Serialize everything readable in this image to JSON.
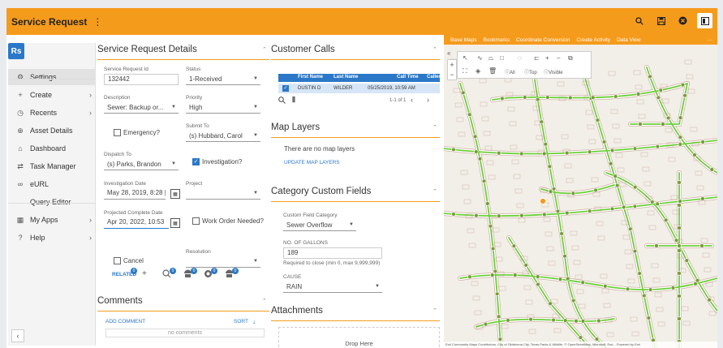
{
  "app": {
    "title": "Service Request",
    "menu_dots": "⋮",
    "logo": "Rs"
  },
  "topbar_icons": [
    "search-icon",
    "save-icon",
    "close-icon",
    "panel-icon"
  ],
  "sidebar": {
    "items": [
      {
        "icon": "⚙",
        "label": "Settings",
        "arrow": "",
        "active": true
      },
      {
        "icon": "+",
        "label": "Create",
        "arrow": "›"
      },
      {
        "icon": "◷",
        "label": "Recents",
        "arrow": "›"
      },
      {
        "icon": "⊕",
        "label": "Asset Details",
        "arrow": ""
      },
      {
        "icon": "⌂",
        "label": "Dashboard",
        "arrow": ""
      },
      {
        "icon": "⇄",
        "label": "Task Manager",
        "arrow": ""
      },
      {
        "icon": "∞",
        "label": "eURL",
        "arrow": ""
      },
      {
        "icon": "",
        "label": "Query Editor",
        "arrow": ""
      },
      {
        "icon": "▦",
        "label": "My Apps",
        "arrow": "›"
      },
      {
        "icon": "?",
        "label": "Help",
        "arrow": "›"
      }
    ],
    "collapse": "‹"
  },
  "details": {
    "title": "Service Request Details",
    "request_id_label": "Service Request Id",
    "request_id": "132442",
    "status_label": "Status",
    "status": "1-Received",
    "description_label": "Description",
    "description": "Sewer: Backup or...",
    "priority_label": "Priority",
    "priority": "High",
    "emergency_label": "Emergency?",
    "submit_to_label": "Submit To",
    "submit_to": "(s) Hubbard, Carol",
    "dispatch_to_label": "Dispatch To",
    "dispatch_to": "(s) Parks, Brandon",
    "investigation_label": "Investigation?",
    "investigation_date_label": "Investigation Date",
    "investigation_date": "May 28, 2019, 8:28 |",
    "project_label": "Project",
    "project": "",
    "projected_complete_label": "Projected Complete Date",
    "projected_complete": "Apr 20, 2022, 10:53",
    "work_order_label": "Work Order Needed?",
    "resolution_label": "Resolution",
    "resolution": "",
    "cancel_label": "Cancel",
    "related_label": "RELATED",
    "related_badge": "0",
    "badges": [
      "0",
      "0",
      "0",
      "0"
    ]
  },
  "comments": {
    "title": "Comments",
    "add": "ADD COMMENT",
    "sort": "SORT",
    "empty": "no comments"
  },
  "customer_calls": {
    "title": "Customer Calls",
    "columns": [
      "First Name",
      "Last Name",
      "Call Time",
      "Caller"
    ],
    "rows": [
      {
        "first": "DUSTIN D",
        "last": "WILDER",
        "time": "05/25/2019, 10:59 AM",
        "caller": ""
      }
    ],
    "pager": "1-1 of 1"
  },
  "map_layers": {
    "title": "Map Layers",
    "empty": "There are no map layers",
    "update": "UPDATE MAP LAYERS"
  },
  "custom_fields": {
    "title": "Category Custom Fields",
    "category_label": "Custom Field Category",
    "category": "Sewer Overflow",
    "gallons_label": "NO. OF GALLONS",
    "gallons": "189",
    "gallons_hint": "Required to close (min 0, max 9,999,999)",
    "cause_label": "CAUSE",
    "cause": "RAIN"
  },
  "attachments": {
    "title": "Attachments",
    "drop": "Drop Here"
  },
  "map": {
    "toolbar": [
      "Base Maps",
      "Bookmarks",
      "Coordinate Conversion",
      "Create Activity",
      "Data View",
      "···"
    ],
    "filters": [
      "All",
      "Top",
      "Visible"
    ],
    "attribution": "Esri Community Maps Contributors, City of Oklahoma City, Texas Parks & Wildlife, © OpenStreetMap, Microsoft, Esri... Powered by Esri",
    "colors": {
      "road": "#ffffff",
      "pipe": "#6ccf3a",
      "node": "#7a9a3a",
      "marker": "#f59b1c",
      "outline": "#b07c6a"
    }
  }
}
